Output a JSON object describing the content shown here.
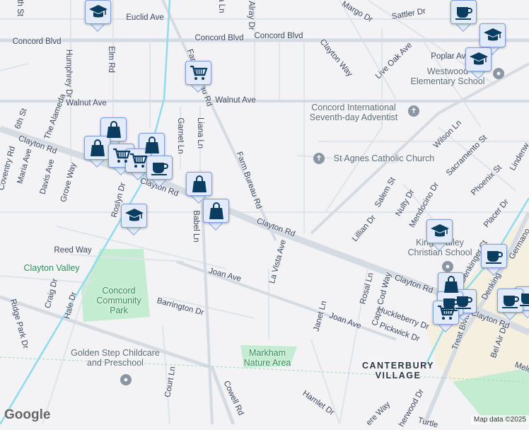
{
  "map": {
    "attribution": "Map data ©2025",
    "logo": "Google"
  },
  "colors": {
    "background": "#f3f2f4",
    "road": "#d5dbe3",
    "park": "#c4ecd0",
    "commercial": "#f5efdf",
    "water": "#8fdcec",
    "marker_fill": "#e3ebfb",
    "marker_icon": "#0b3d60"
  },
  "labels": {
    "streets": [
      "Euclid Ave",
      "Concord Blvd",
      "Concord Blvd",
      "Concord Blvd",
      "Walnut Ave",
      "Walnut Ave",
      "Clayton Rd",
      "Clayton Rd",
      "Clayton Rd",
      "Clayton Rd",
      "Clayton Rd",
      "Farm Bureau Rd",
      "Farm Bureau Rd",
      "Elm Rd",
      "Humphrey Dr",
      "The Alameda",
      "6th St",
      "Coventry Rd",
      "Maria Ave",
      "Davis Ave",
      "Grove Way",
      "Roslyn Dr",
      "Garnet Ln",
      "Liana Ln",
      "Babel Ln",
      "Alray Dr",
      "Margo Dr",
      "Sattler Dr",
      "Clayton Way",
      "Live Oak Ave",
      "Poplar Ave",
      "Wilson Ln",
      "Sacramento St",
      "Phoenix St",
      "Lindenw",
      "Salem St",
      "Nulty Dr",
      "Mendocino Dr",
      "Lillian Dr",
      "Placer Dr",
      "Denkinger Ct",
      "Reed Way",
      "Craig Dr",
      "Hale Dr",
      "Barrington Dr",
      "Joan Ave",
      "La Vista Ave",
      "Janet Ln",
      "Rosal Ln",
      "Cape Cod Way",
      "Joan Ave",
      "Huckleberry Dr",
      "Pickwick Dr",
      "Ridge Park Dr",
      "Court Ln",
      "Cowell Rd",
      "Hamlet Dr",
      "ere Way",
      "herwood Dr",
      "Treat Blvd",
      "Bel Air Dr",
      "Melo",
      "Turtle",
      "6th St",
      "la Ln",
      "Denking",
      "Germano"
    ],
    "pois": {
      "westwood": [
        "Westwood",
        "Elementary School"
      ],
      "adventist": [
        "Concord International",
        "Seventh-day Adventist"
      ],
      "st_agnes": "St Agnes Catholic Church",
      "kings_valley": [
        "Kings Valley",
        "Christian School"
      ],
      "clayton_valley": "Clayton Valley",
      "community_park": [
        "Concord",
        "Community",
        "Park"
      ],
      "golden_step": [
        "Golden Step Childcare",
        "and Preschool"
      ],
      "markham": [
        "Markham",
        "Nature Area"
      ],
      "canterbury": [
        "CANTERBURY",
        "VILLAGE"
      ]
    }
  },
  "markers": [
    "school",
    "cart",
    "bag",
    "bag",
    "bag",
    "cart",
    "cart",
    "coffee",
    "bag",
    "bag",
    "school",
    "coffee",
    "school",
    "school",
    "school",
    "coffee",
    "bag",
    "coffee",
    "coffee",
    "cart",
    "coffee",
    "coffee"
  ]
}
